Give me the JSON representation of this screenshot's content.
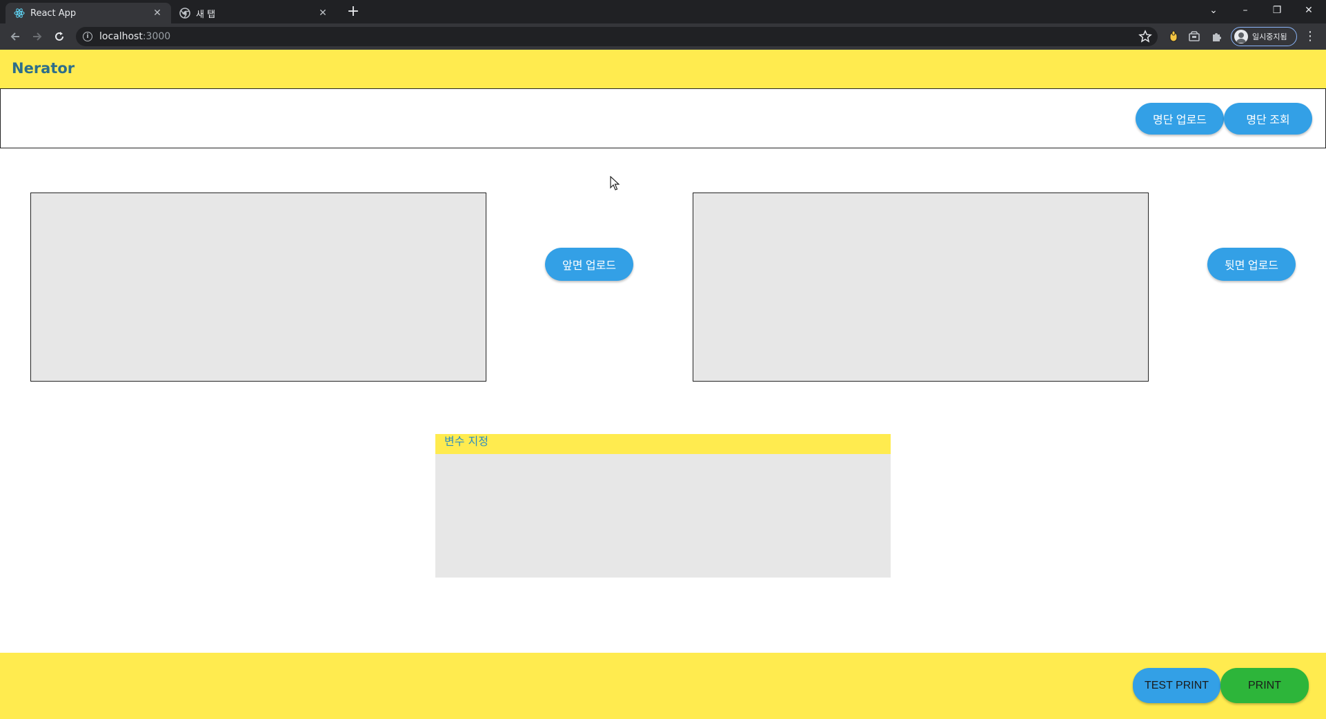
{
  "browser": {
    "tabs": [
      {
        "title": "React App",
        "icon": "react-icon",
        "active": true
      },
      {
        "title": "새 탭",
        "icon": "chrome-icon",
        "active": false
      }
    ],
    "new_tab_label": "+",
    "url_host": "localhost",
    "url_port": ":3000",
    "profile_label": "일시중지됨",
    "window_controls": {
      "chevron": "⌄",
      "minimize": "–",
      "restore": "❐",
      "close": "✕"
    }
  },
  "app": {
    "logo": "Nerator",
    "list_upload_label": "명단 업로드",
    "list_view_label": "명단 조회",
    "front_upload_label": "앞면 업로드",
    "back_upload_label": "뒷면 업로드",
    "variables_title": "변수 지정",
    "test_print_label": "TEST PRINT",
    "print_label": "PRINT"
  },
  "colors": {
    "header_yellow": "#ffeb4f",
    "button_blue": "#33a0e6",
    "print_green": "#2db53a",
    "panel_gray": "#e7e7e7",
    "logo_teal": "#2d6e8a"
  }
}
